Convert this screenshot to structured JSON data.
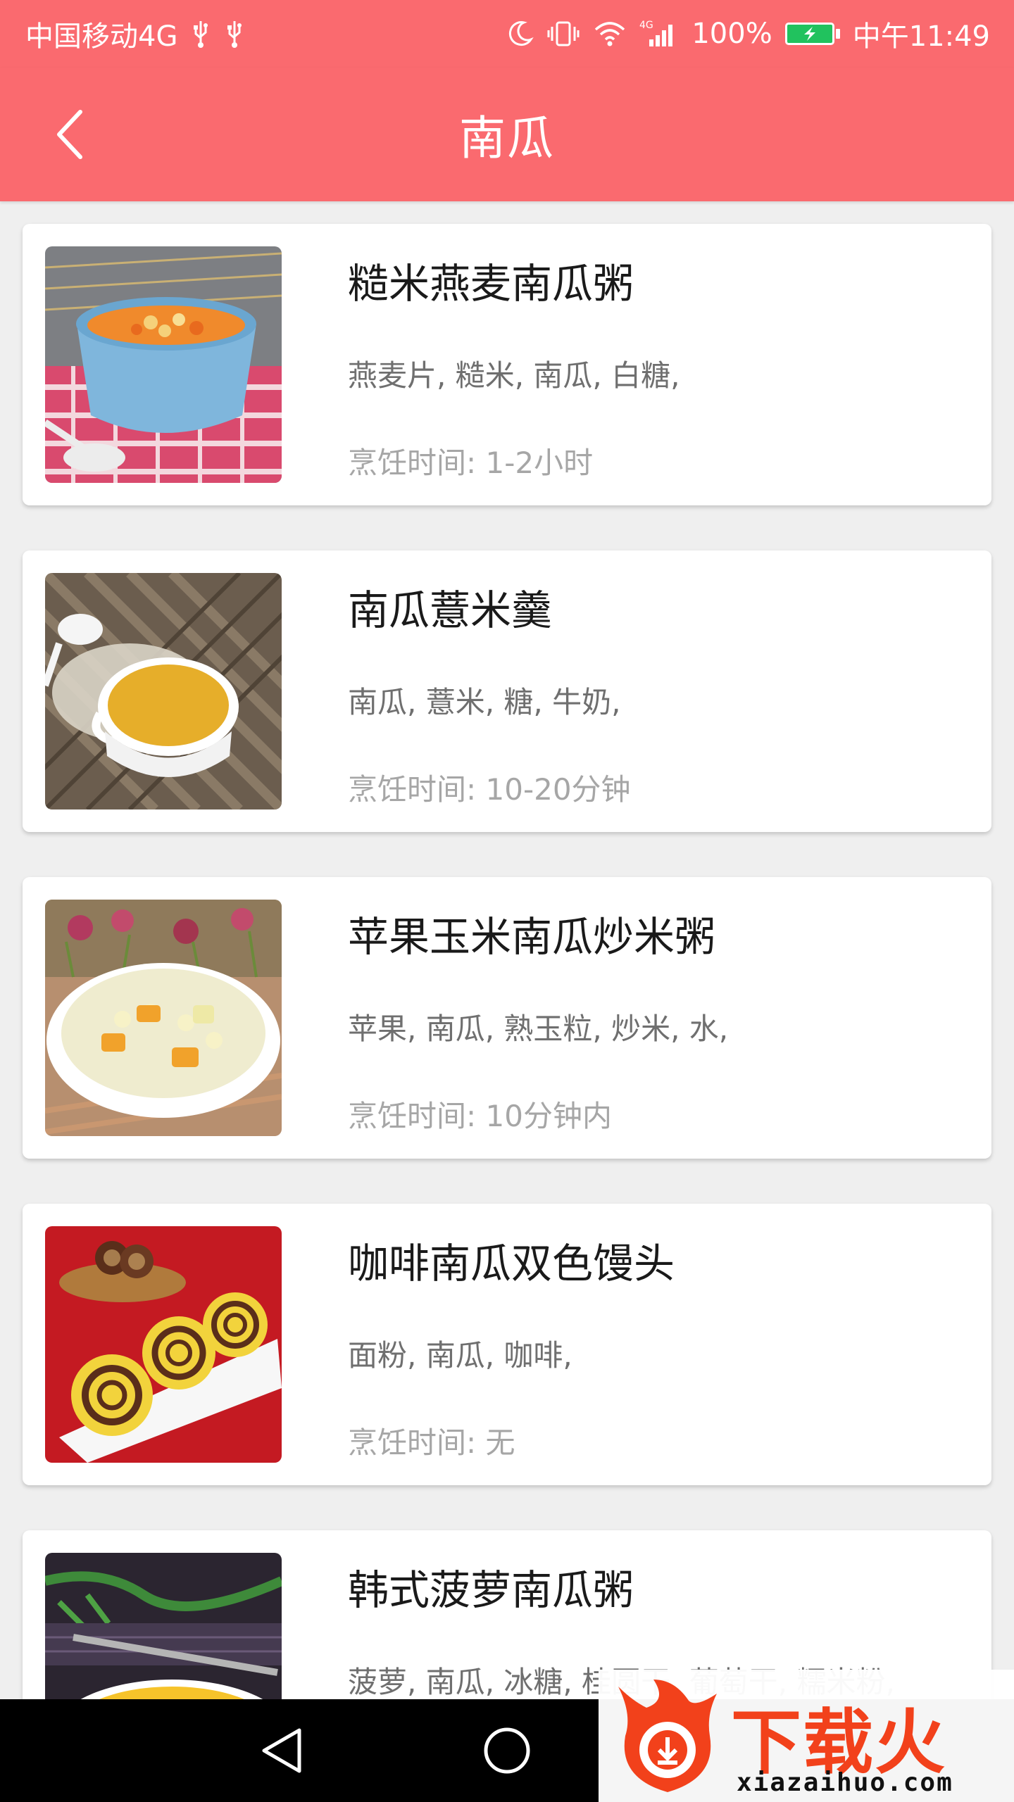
{
  "status_bar": {
    "carrier": "中国移动4G",
    "battery_percent": "100%",
    "time": "中午11:49",
    "battery_color": "#21c25e"
  },
  "header": {
    "title": "南瓜",
    "background": "#fa6a6f"
  },
  "recipes": [
    {
      "title": "糙米燕麦南瓜粥",
      "ingredients": "燕麦片, 糙米, 南瓜, 白糖,",
      "cook_time": "烹饪时间: 1-2小时",
      "image_icon": "pumpkin-porridge-bowl-photo"
    },
    {
      "title": "南瓜薏米羹",
      "ingredients": "南瓜, 薏米, 糖, 牛奶,",
      "cook_time": "烹饪时间: 10-20分钟",
      "image_icon": "pumpkin-soup-cup-photo"
    },
    {
      "title": "苹果玉米南瓜炒米粥",
      "ingredients": "苹果, 南瓜, 熟玉粒, 炒米, 水,",
      "cook_time": "烹饪时间: 10分钟内",
      "image_icon": "apple-corn-porridge-photo"
    },
    {
      "title": "咖啡南瓜双色馒头",
      "ingredients": "面粉, 南瓜, 咖啡,",
      "cook_time": "烹饪时间: 无",
      "image_icon": "swirl-buns-photo"
    },
    {
      "title": "韩式菠萝南瓜粥",
      "ingredients": "菠萝, 南瓜, 冰糖, 桂圆干, 葡萄干, 糯米粉,",
      "cook_time": "",
      "image_icon": "pineapple-porridge-photo"
    }
  ],
  "watermark": {
    "text": "下载火",
    "domain": "xiazaihuo.com"
  }
}
